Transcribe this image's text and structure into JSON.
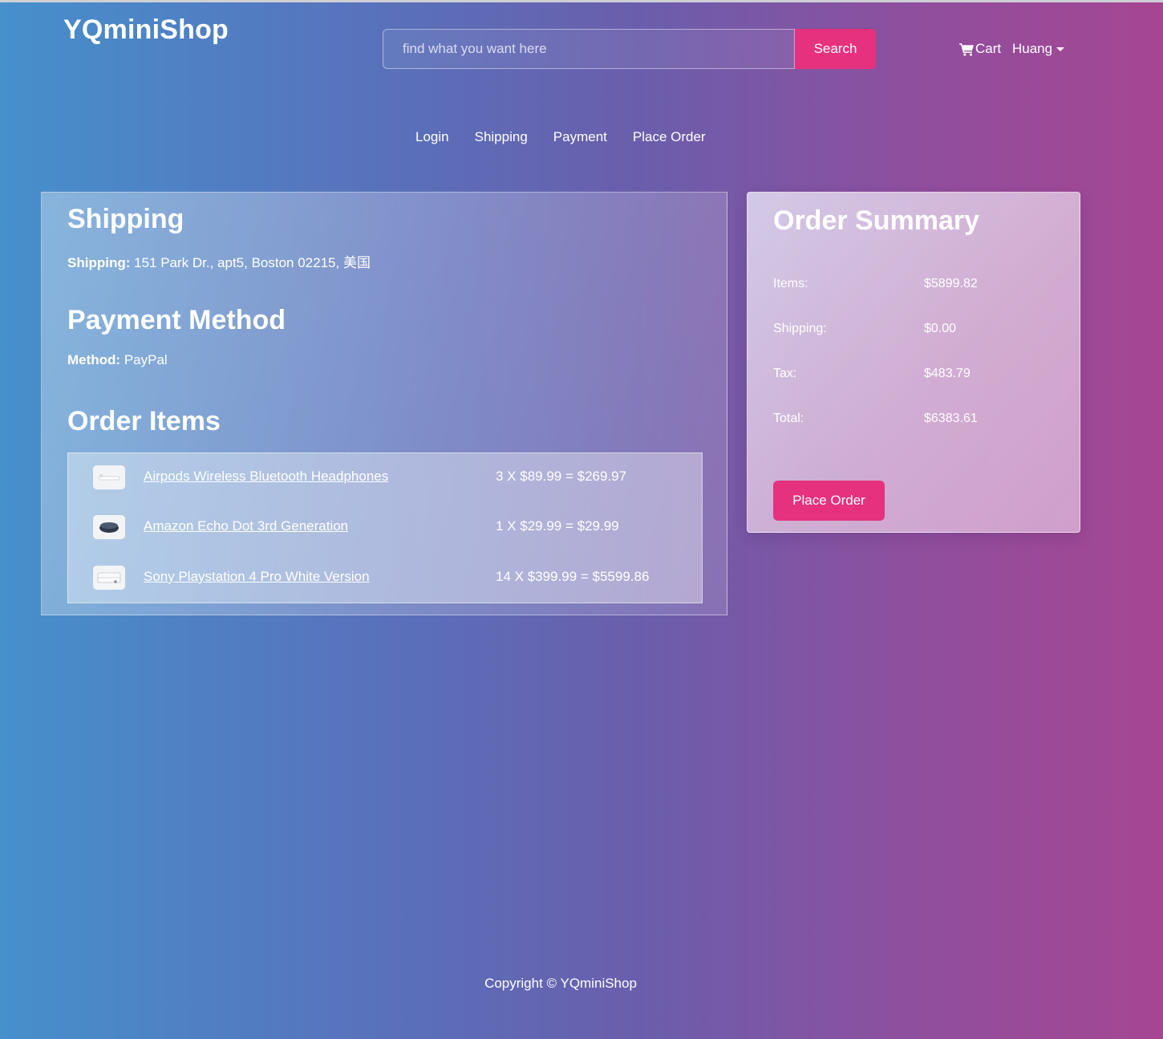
{
  "header": {
    "brand": "YQminiShop",
    "search": {
      "placeholder": "find what you want here",
      "value": "",
      "button_label": "Search"
    },
    "cart_label": "Cart",
    "user_label": "Huang"
  },
  "steps": [
    "Login",
    "Shipping",
    "Payment",
    "Place Order"
  ],
  "shipping": {
    "title": "Shipping",
    "label": "Shipping:",
    "address": "151 Park Dr., apt5, Boston 02215, 美国"
  },
  "payment": {
    "title": "Payment Method",
    "label": "Method:",
    "method": "PayPal"
  },
  "order_items": {
    "title": "Order Items",
    "items": [
      {
        "name": "Airpods Wireless Bluetooth Headphones",
        "calc": "3 X $89.99 = $269.97",
        "icon": "airpods-thumbnail-icon"
      },
      {
        "name": "Amazon Echo Dot 3rd Generation",
        "calc": "1 X $29.99 = $29.99",
        "icon": "echo-dot-thumbnail-icon"
      },
      {
        "name": "Sony Playstation 4 Pro White Version",
        "calc": "14 X $399.99 = $5599.86",
        "icon": "playstation-thumbnail-icon"
      }
    ]
  },
  "summary": {
    "title": "Order Summary",
    "rows": [
      {
        "label": "Items:",
        "value": "$5899.82"
      },
      {
        "label": "Shipping:",
        "value": "$0.00"
      },
      {
        "label": "Tax:",
        "value": "$483.79"
      },
      {
        "label": "Total:",
        "value": "$6383.61"
      }
    ],
    "button_label": "Place Order"
  },
  "footer": {
    "copyright": "Copyright © YQminiShop"
  },
  "colors": {
    "accent": "#e6317e",
    "gradient_start": "#4690cc",
    "gradient_end": "#a64692"
  }
}
